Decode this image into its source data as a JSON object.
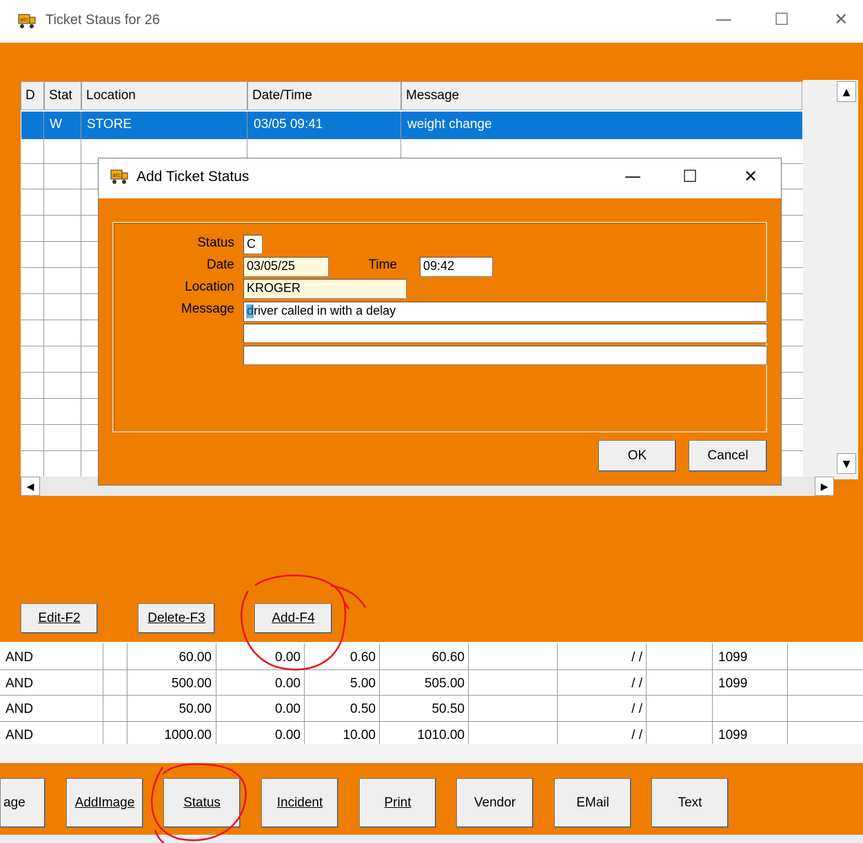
{
  "window": {
    "title": "Ticket Staus for 26",
    "icon": "truck-icon"
  },
  "status_grid": {
    "columns": [
      "D",
      "Stat",
      "Location",
      "Date/Time",
      "Message"
    ],
    "rows": [
      {
        "d": "",
        "stat": "W",
        "location": "STORE",
        "datetime": "03/05 09:41",
        "message": "weight change"
      }
    ]
  },
  "dialog": {
    "title": "Add Ticket Status",
    "status_label": "Status",
    "status_value": "C",
    "date_label": "Date",
    "date_value": "03/05/25",
    "time_label": "Time",
    "time_value": "09:42",
    "location_label": "Location",
    "location_value": "KROGER",
    "message_label": "Message",
    "message_lines": [
      "driver called in with a delay",
      "",
      ""
    ],
    "ok": "OK",
    "cancel": "Cancel"
  },
  "grid_buttons": {
    "edit": "Edit-F2",
    "delete": "Delete-F3",
    "add": "Add-F4"
  },
  "data_rows": [
    [
      "AND",
      "60.00",
      "0.00",
      "0.60",
      "60.60",
      "/ /",
      "1099"
    ],
    [
      "AND",
      "500.00",
      "0.00",
      "5.00",
      "505.00",
      "/ /",
      "1099"
    ],
    [
      "AND",
      "50.00",
      "0.00",
      "0.50",
      "50.50",
      "/ /",
      ""
    ],
    [
      "AND",
      "1000.00",
      "0.00",
      "10.00",
      "1010.00",
      "/ /",
      "1099"
    ]
  ],
  "bottom_buttons": [
    "age",
    "AddImage",
    "Status",
    "Incident",
    "Print",
    "Vendor",
    "EMail",
    "Text"
  ],
  "colors": {
    "accent": "#ef7d00",
    "selection": "#0a78d7",
    "annotation": "#e8141c"
  }
}
